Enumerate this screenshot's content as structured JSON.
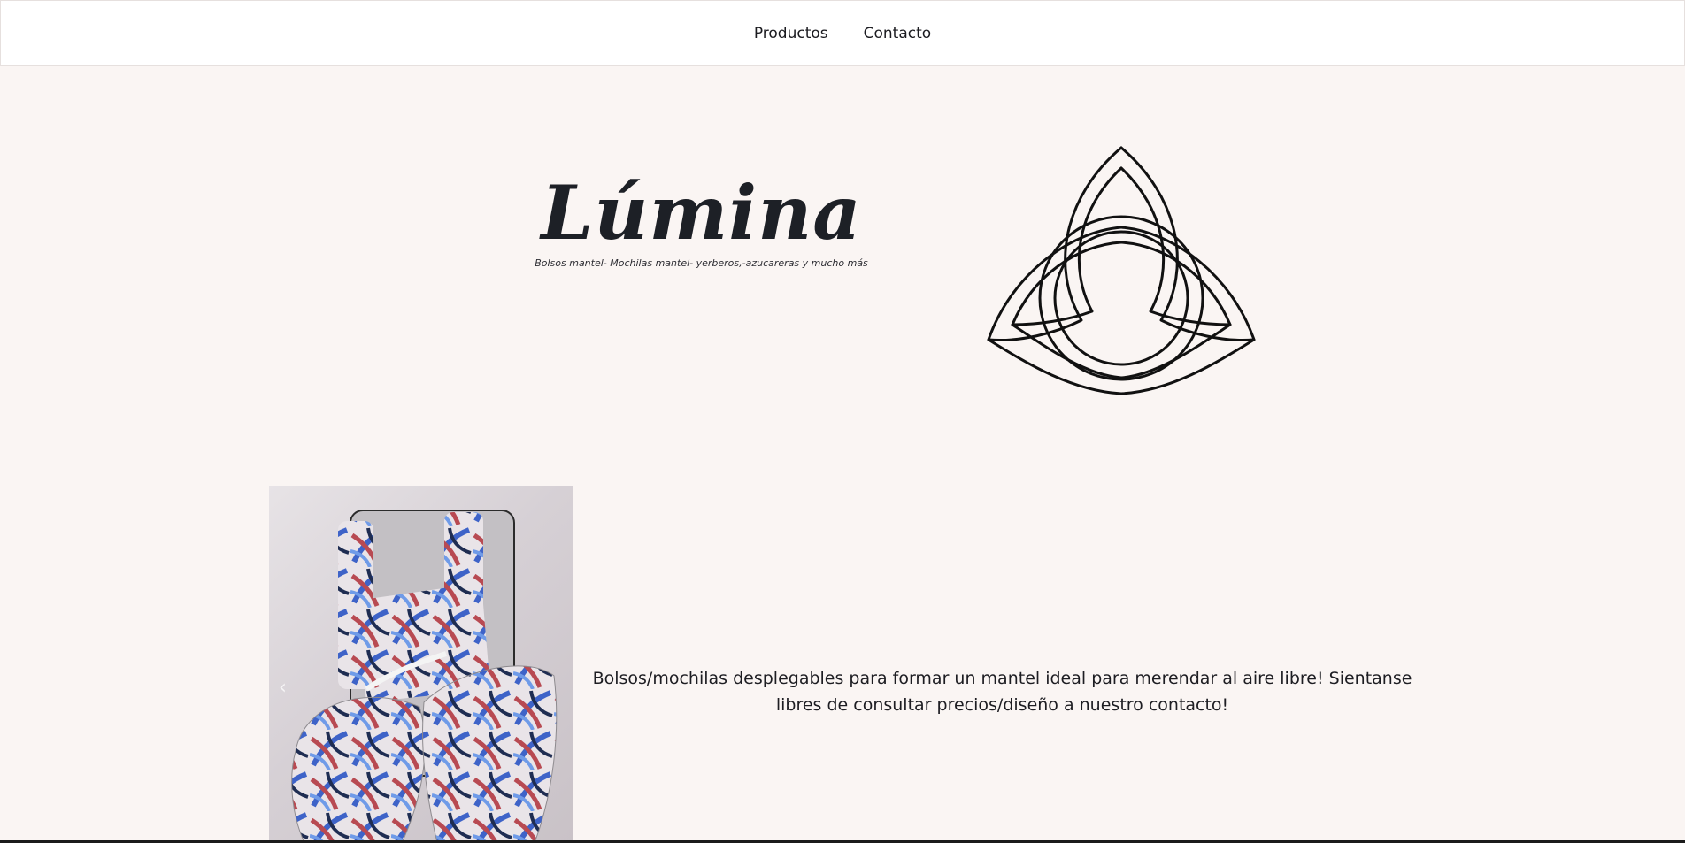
{
  "nav": {
    "items": [
      {
        "label": "Productos"
      },
      {
        "label": "Contacto"
      }
    ]
  },
  "hero": {
    "title": "Lúmina",
    "tagline": "Bolsos mantel- Mochilas mantel- yerberos,-azucareras y mucho más",
    "logo_icon": "triquetra-icon"
  },
  "product": {
    "description": "Bolsos/mochilas desplegables para formar un mantel ideal para merendar al aire libre! Sientanse libres de consultar precios/diseño a nuestro contacto!",
    "prev_icon": "chevron-left-icon"
  },
  "colors": {
    "background": "#faf5f3",
    "nav_background": "#ffffff",
    "text": "#1d2026"
  }
}
